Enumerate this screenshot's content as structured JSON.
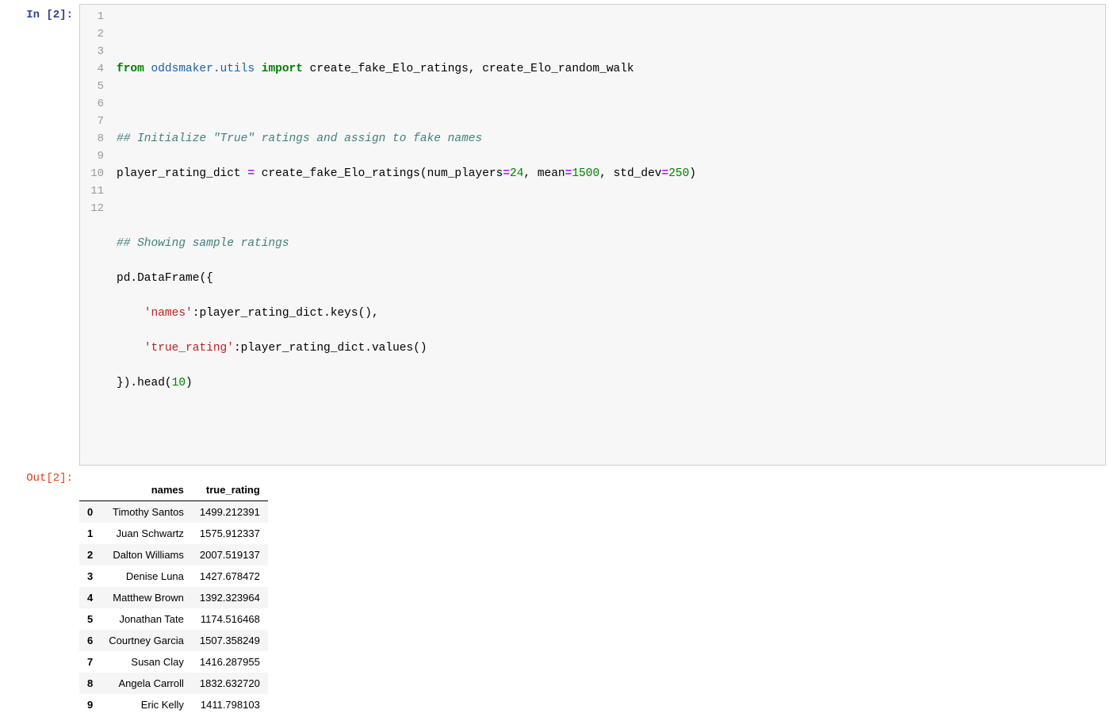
{
  "in_prompt": "In [2]:",
  "out_prompt": "Out[2]:",
  "line_numbers": [
    "1",
    "2",
    "3",
    "4",
    "5",
    "6",
    "7",
    "8",
    "9",
    "10",
    "11",
    "12"
  ],
  "code": {
    "l2": {
      "from": "from",
      "mod": "oddsmaker.utils",
      "import": "import",
      "names": "create_fake_Elo_ratings, create_Elo_random_walk"
    },
    "l4_comment": "## Initialize \"True\" ratings and assign to fake names",
    "l5": {
      "var": "player_rating_dict",
      "eq": "=",
      "fn": "create_fake_Elo_ratings",
      "open": "(",
      "kw1": "num_players",
      "eq1": "=",
      "v1": "24",
      "c1": ", ",
      "kw2": "mean",
      "eq2": "=",
      "v2": "1500",
      "c2": ", ",
      "kw3": "std_dev",
      "eq3": "=",
      "v3": "250",
      "close": ")"
    },
    "l7_comment": "## Showing sample ratings",
    "l8": {
      "pd": "pd",
      "dot1": ".",
      "df": "DataFrame",
      "open": "({"
    },
    "l9": {
      "indent": "    ",
      "key": "'names'",
      "colon": ":",
      "obj": "player_rating_dict",
      "dot": ".",
      "meth": "keys",
      "paren": "(),"
    },
    "l10": {
      "indent": "    ",
      "key": "'true_rating'",
      "colon": ":",
      "obj": "player_rating_dict",
      "dot": ".",
      "meth": "values",
      "paren": "()"
    },
    "l11": {
      "close": "}).",
      "head": "head",
      "open": "(",
      "n": "10",
      "cparen": ")"
    }
  },
  "table": {
    "columns": [
      "names",
      "true_rating"
    ],
    "rows": [
      {
        "idx": "0",
        "names": "Timothy Santos",
        "true_rating": "1499.212391"
      },
      {
        "idx": "1",
        "names": "Juan Schwartz",
        "true_rating": "1575.912337"
      },
      {
        "idx": "2",
        "names": "Dalton Williams",
        "true_rating": "2007.519137"
      },
      {
        "idx": "3",
        "names": "Denise Luna",
        "true_rating": "1427.678472"
      },
      {
        "idx": "4",
        "names": "Matthew Brown",
        "true_rating": "1392.323964"
      },
      {
        "idx": "5",
        "names": "Jonathan Tate",
        "true_rating": "1174.516468"
      },
      {
        "idx": "6",
        "names": "Courtney Garcia",
        "true_rating": "1507.358249"
      },
      {
        "idx": "7",
        "names": "Susan Clay",
        "true_rating": "1416.287955"
      },
      {
        "idx": "8",
        "names": "Angela Carroll",
        "true_rating": "1832.632720"
      },
      {
        "idx": "9",
        "names": "Eric Kelly",
        "true_rating": "1411.798103"
      }
    ]
  }
}
